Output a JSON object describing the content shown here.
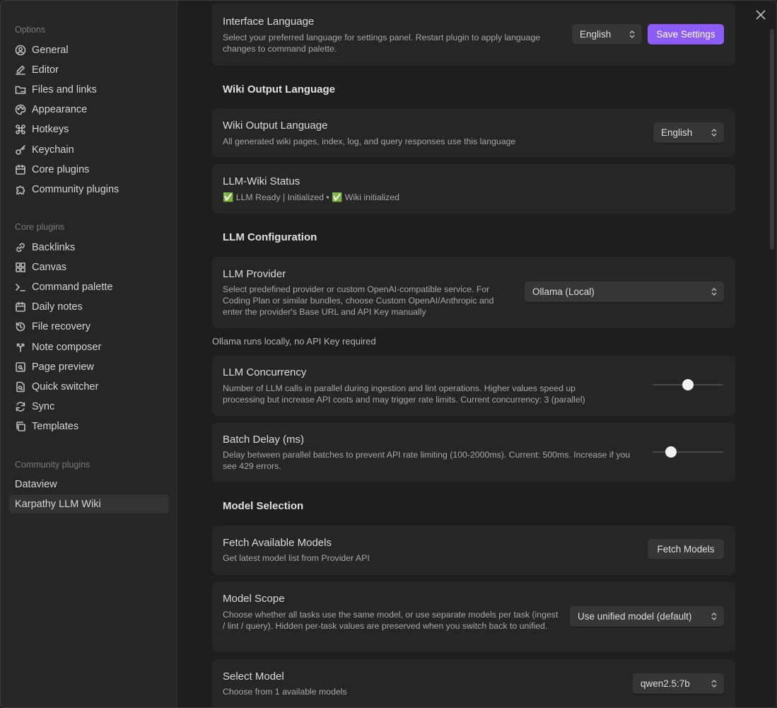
{
  "sidebar": {
    "options_title": "Options",
    "options": [
      {
        "label": "General",
        "icon": "gear-circle-icon"
      },
      {
        "label": "Editor",
        "icon": "pencil-icon"
      },
      {
        "label": "Files and links",
        "icon": "folder-icon"
      },
      {
        "label": "Appearance",
        "icon": "palette-icon"
      },
      {
        "label": "Hotkeys",
        "icon": "command-icon"
      },
      {
        "label": "Keychain",
        "icon": "key-icon"
      },
      {
        "label": "Core plugins",
        "icon": "calendar-box-icon"
      },
      {
        "label": "Community plugins",
        "icon": "puzzle-icon"
      }
    ],
    "core_title": "Core plugins",
    "core": [
      {
        "label": "Backlinks",
        "icon": "link-icon"
      },
      {
        "label": "Canvas",
        "icon": "grid-icon"
      },
      {
        "label": "Command palette",
        "icon": "terminal-icon"
      },
      {
        "label": "Daily notes",
        "icon": "calendar-icon"
      },
      {
        "label": "File recovery",
        "icon": "history-icon"
      },
      {
        "label": "Note composer",
        "icon": "merge-icon"
      },
      {
        "label": "Page preview",
        "icon": "preview-icon"
      },
      {
        "label": "Quick switcher",
        "icon": "file-search-icon"
      },
      {
        "label": "Sync",
        "icon": "sync-icon"
      },
      {
        "label": "Templates",
        "icon": "copy-icon"
      }
    ],
    "community_title": "Community plugins",
    "community": [
      {
        "label": "Dataview"
      },
      {
        "label": "Karpathy LLM Wiki",
        "active": true
      }
    ]
  },
  "main": {
    "interface_language": {
      "title": "Interface Language",
      "desc": "Select your preferred language for settings panel. Restart plugin to apply language changes to command palette.",
      "select_value": "English",
      "save_label": "Save Settings"
    },
    "wiki_output_heading": "Wiki Output Language",
    "wiki_output": {
      "title": "Wiki Output Language",
      "desc": "All generated wiki pages, index, log, and query responses use this language",
      "select_value": "English"
    },
    "status": {
      "title": "LLM-Wiki Status",
      "desc": "✅ LLM Ready | Initialized • ✅ Wiki initialized"
    },
    "llm_config_heading": "LLM Configuration",
    "provider": {
      "title": "LLM Provider",
      "desc": "Select predefined provider or custom OpenAI-compatible service. For Coding Plan or similar bundles, choose Custom OpenAI/Anthropic and enter the provider's Base URL and API Key manually",
      "select_value": "Ollama (Local)"
    },
    "provider_note": "Ollama runs locally, no API Key required",
    "concurrency": {
      "title": "LLM Concurrency",
      "desc": "Number of LLM calls in parallel during ingestion and lint operations. Higher values speed up processing but increase API costs and may trigger rate limits. Current concurrency: 3 (parallel)",
      "slider_fraction": 0.5
    },
    "batch_delay": {
      "title": "Batch Delay (ms)",
      "desc": "Delay between parallel batches to prevent API rate limiting (100-2000ms). Current: 500ms. Increase if you see 429 errors.",
      "slider_fraction": 0.26
    },
    "model_selection_heading": "Model Selection",
    "fetch_models": {
      "title": "Fetch Available Models",
      "desc": "Get latest model list from Provider API",
      "button_label": "Fetch Models"
    },
    "model_scope": {
      "title": "Model Scope",
      "desc": "Choose whether all tasks use the same model, or use separate models per task (ingest / lint / query). Hidden per-task values are preserved when you switch back to unified.",
      "select_value": "Use unified model (default)"
    },
    "select_model": {
      "title": "Select Model",
      "desc": "Choose from 1 available models",
      "select_value": "qwen2.5:7b"
    }
  },
  "colors": {
    "accent": "#8b5cf6",
    "background": "#1e1e1e",
    "sidebar": "#262626",
    "card": "#262626"
  }
}
